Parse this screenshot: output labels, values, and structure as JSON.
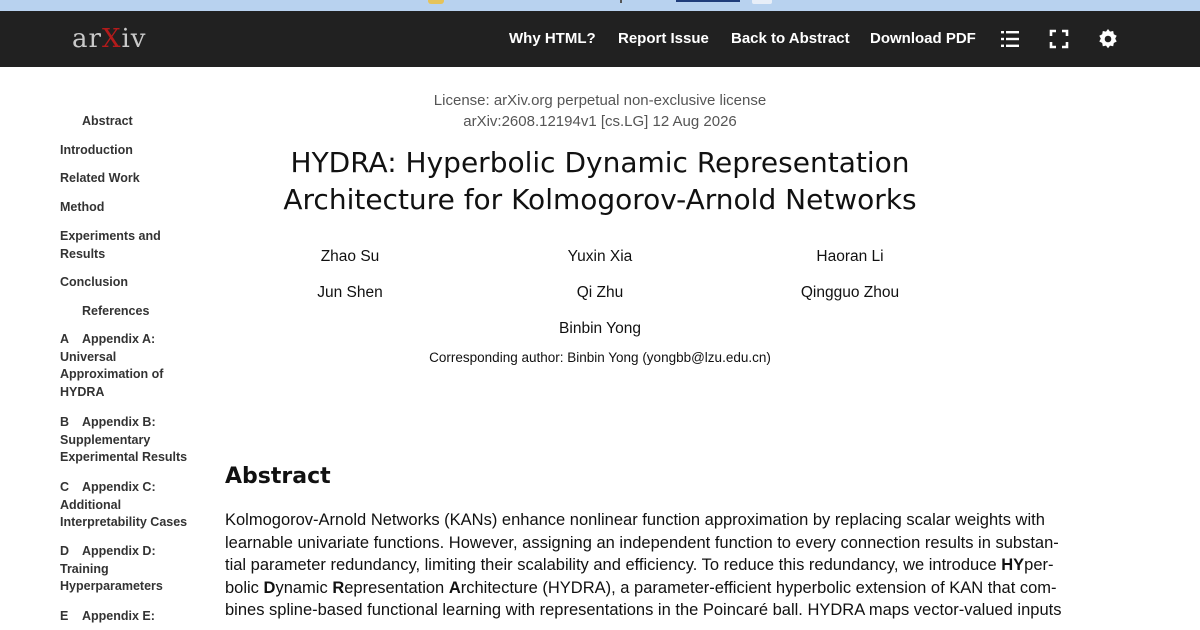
{
  "header": {
    "logo": {
      "pre": "ar",
      "x": "X",
      "post": "iv"
    },
    "nav": {
      "why_html": "Why HTML?",
      "report_issue": "Report Issue",
      "back_to_abstract": "Back to Abstract",
      "download_pdf": "Download PDF"
    },
    "icons": [
      "list-icon",
      "fullscreen-icon",
      "settings-icon"
    ]
  },
  "toc": [
    {
      "num": "",
      "label": "Abstract"
    },
    {
      "num": "",
      "label": "Introduction"
    },
    {
      "num": "",
      "label": "Related Work"
    },
    {
      "num": "",
      "label": "Method"
    },
    {
      "num": "",
      "label": "Experiments and Results"
    },
    {
      "num": "",
      "label": "Conclusion"
    },
    {
      "num": "",
      "label": "References"
    },
    {
      "num": "A",
      "label": "Appendix A: Universal Approximation of HYDRA"
    },
    {
      "num": "B",
      "label": "Appendix B: Supplementary Experimental Results"
    },
    {
      "num": "C",
      "label": "Appendix C: Additional Interpretability Cases"
    },
    {
      "num": "D",
      "label": "Appendix D: Training Hyperparameters"
    },
    {
      "num": "E",
      "label": "Appendix E:"
    }
  ],
  "paper": {
    "license": "License: arXiv.org perpetual non-exclusive license",
    "arxiv_id": "arXiv:2608.12194v1 [cs.LG] 12 Aug 2026",
    "title_line1": "HYDRA: Hyperbolic Dynamic Representation",
    "title_line2": "Architecture for Kolmogorov-Arnold Networks",
    "authors": [
      "Zhao Su",
      "Yuxin Xia",
      "Haoran Li",
      "Jun Shen",
      "Qi Zhu",
      "Qingguo Zhou",
      "Binbin Yong"
    ],
    "corresponding": "Corresponding author: Binbin Yong (yongbb@lzu.edu.cn)",
    "abstract_heading": "Abstract",
    "abstract_lines": [
      "Kolmogorov-Arnold Networks (KANs) enhance nonlinear function approximation by replacing scalar weights with",
      "learnable univariate functions. However, assigning an independent function to every connection results in substan-",
      "tial parameter redundancy, limiting their scalability and efficiency. To reduce this redundancy, we introduce HYper-",
      "bolic Dynamic Representation Architecture (HYDRA), a parameter-efficient hyperbolic extension of KAN that com-",
      "bines spline-based functional learning with representations in the Poincaré ball. HYDRA maps vector-valued inputs"
    ]
  }
}
